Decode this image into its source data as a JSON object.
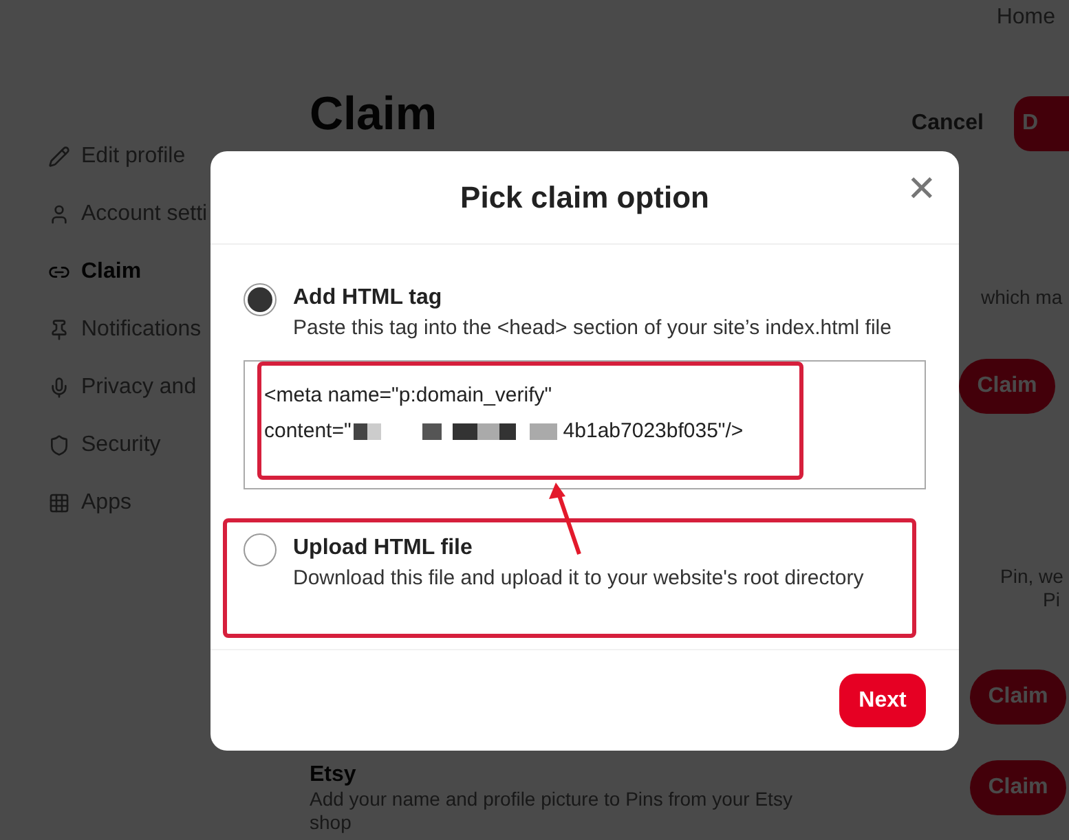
{
  "page": {
    "breadcrumb": "Home",
    "title": "Claim",
    "cancel_label": "Cancel",
    "primary_label": "D",
    "sidebar": [
      {
        "label": "Edit profile",
        "selected": false
      },
      {
        "label": "Account setti",
        "selected": false
      },
      {
        "label": "Claim",
        "selected": true
      },
      {
        "label": "Notifications",
        "selected": false
      },
      {
        "label": "Privacy and",
        "selected": false
      },
      {
        "label": "Security",
        "selected": false
      },
      {
        "label": "Apps",
        "selected": false
      }
    ],
    "right_texts": [
      [
        "which ma"
      ],
      [
        "Pin, we",
        "Pi"
      ]
    ],
    "claim_buttons": [
      "Claim",
      "Claim",
      "Claim"
    ],
    "etsy": {
      "title": "Etsy",
      "description": "Add your name and profile picture to Pins from your Etsy",
      "description_2": "shop"
    }
  },
  "dialog": {
    "title": "Pick claim option",
    "close": "✕",
    "options": [
      {
        "title": "Add HTML tag",
        "description": "Paste this tag into the <head> section of your site’s index.html file",
        "selected": true
      },
      {
        "title": "Upload HTML file",
        "description": "Download this file and upload it to your website's root directory",
        "selected": false
      }
    ],
    "tag_line_1": "<meta name=\"p:domain_verify\"",
    "tag_prefix": "content=\"",
    "tag_suffix": "4b1ab7023bf035\"/>",
    "next_label": "Next"
  }
}
